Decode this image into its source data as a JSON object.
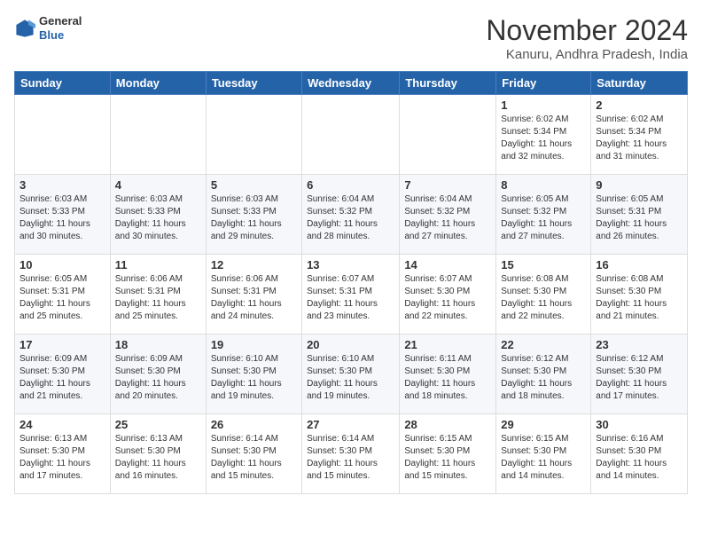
{
  "header": {
    "logo": {
      "general": "General",
      "blue": "Blue"
    },
    "title": "November 2024",
    "location": "Kanuru, Andhra Pradesh, India"
  },
  "calendar": {
    "days_of_week": [
      "Sunday",
      "Monday",
      "Tuesday",
      "Wednesday",
      "Thursday",
      "Friday",
      "Saturday"
    ],
    "weeks": [
      [
        {
          "day": "",
          "info": ""
        },
        {
          "day": "",
          "info": ""
        },
        {
          "day": "",
          "info": ""
        },
        {
          "day": "",
          "info": ""
        },
        {
          "day": "",
          "info": ""
        },
        {
          "day": "1",
          "info": "Sunrise: 6:02 AM\nSunset: 5:34 PM\nDaylight: 11 hours and 32 minutes."
        },
        {
          "day": "2",
          "info": "Sunrise: 6:02 AM\nSunset: 5:34 PM\nDaylight: 11 hours and 31 minutes."
        }
      ],
      [
        {
          "day": "3",
          "info": "Sunrise: 6:03 AM\nSunset: 5:33 PM\nDaylight: 11 hours and 30 minutes."
        },
        {
          "day": "4",
          "info": "Sunrise: 6:03 AM\nSunset: 5:33 PM\nDaylight: 11 hours and 30 minutes."
        },
        {
          "day": "5",
          "info": "Sunrise: 6:03 AM\nSunset: 5:33 PM\nDaylight: 11 hours and 29 minutes."
        },
        {
          "day": "6",
          "info": "Sunrise: 6:04 AM\nSunset: 5:32 PM\nDaylight: 11 hours and 28 minutes."
        },
        {
          "day": "7",
          "info": "Sunrise: 6:04 AM\nSunset: 5:32 PM\nDaylight: 11 hours and 27 minutes."
        },
        {
          "day": "8",
          "info": "Sunrise: 6:05 AM\nSunset: 5:32 PM\nDaylight: 11 hours and 27 minutes."
        },
        {
          "day": "9",
          "info": "Sunrise: 6:05 AM\nSunset: 5:31 PM\nDaylight: 11 hours and 26 minutes."
        }
      ],
      [
        {
          "day": "10",
          "info": "Sunrise: 6:05 AM\nSunset: 5:31 PM\nDaylight: 11 hours and 25 minutes."
        },
        {
          "day": "11",
          "info": "Sunrise: 6:06 AM\nSunset: 5:31 PM\nDaylight: 11 hours and 25 minutes."
        },
        {
          "day": "12",
          "info": "Sunrise: 6:06 AM\nSunset: 5:31 PM\nDaylight: 11 hours and 24 minutes."
        },
        {
          "day": "13",
          "info": "Sunrise: 6:07 AM\nSunset: 5:31 PM\nDaylight: 11 hours and 23 minutes."
        },
        {
          "day": "14",
          "info": "Sunrise: 6:07 AM\nSunset: 5:30 PM\nDaylight: 11 hours and 22 minutes."
        },
        {
          "day": "15",
          "info": "Sunrise: 6:08 AM\nSunset: 5:30 PM\nDaylight: 11 hours and 22 minutes."
        },
        {
          "day": "16",
          "info": "Sunrise: 6:08 AM\nSunset: 5:30 PM\nDaylight: 11 hours and 21 minutes."
        }
      ],
      [
        {
          "day": "17",
          "info": "Sunrise: 6:09 AM\nSunset: 5:30 PM\nDaylight: 11 hours and 21 minutes."
        },
        {
          "day": "18",
          "info": "Sunrise: 6:09 AM\nSunset: 5:30 PM\nDaylight: 11 hours and 20 minutes."
        },
        {
          "day": "19",
          "info": "Sunrise: 6:10 AM\nSunset: 5:30 PM\nDaylight: 11 hours and 19 minutes."
        },
        {
          "day": "20",
          "info": "Sunrise: 6:10 AM\nSunset: 5:30 PM\nDaylight: 11 hours and 19 minutes."
        },
        {
          "day": "21",
          "info": "Sunrise: 6:11 AM\nSunset: 5:30 PM\nDaylight: 11 hours and 18 minutes."
        },
        {
          "day": "22",
          "info": "Sunrise: 6:12 AM\nSunset: 5:30 PM\nDaylight: 11 hours and 18 minutes."
        },
        {
          "day": "23",
          "info": "Sunrise: 6:12 AM\nSunset: 5:30 PM\nDaylight: 11 hours and 17 minutes."
        }
      ],
      [
        {
          "day": "24",
          "info": "Sunrise: 6:13 AM\nSunset: 5:30 PM\nDaylight: 11 hours and 17 minutes."
        },
        {
          "day": "25",
          "info": "Sunrise: 6:13 AM\nSunset: 5:30 PM\nDaylight: 11 hours and 16 minutes."
        },
        {
          "day": "26",
          "info": "Sunrise: 6:14 AM\nSunset: 5:30 PM\nDaylight: 11 hours and 15 minutes."
        },
        {
          "day": "27",
          "info": "Sunrise: 6:14 AM\nSunset: 5:30 PM\nDaylight: 11 hours and 15 minutes."
        },
        {
          "day": "28",
          "info": "Sunrise: 6:15 AM\nSunset: 5:30 PM\nDaylight: 11 hours and 15 minutes."
        },
        {
          "day": "29",
          "info": "Sunrise: 6:15 AM\nSunset: 5:30 PM\nDaylight: 11 hours and 14 minutes."
        },
        {
          "day": "30",
          "info": "Sunrise: 6:16 AM\nSunset: 5:30 PM\nDaylight: 11 hours and 14 minutes."
        }
      ]
    ]
  }
}
